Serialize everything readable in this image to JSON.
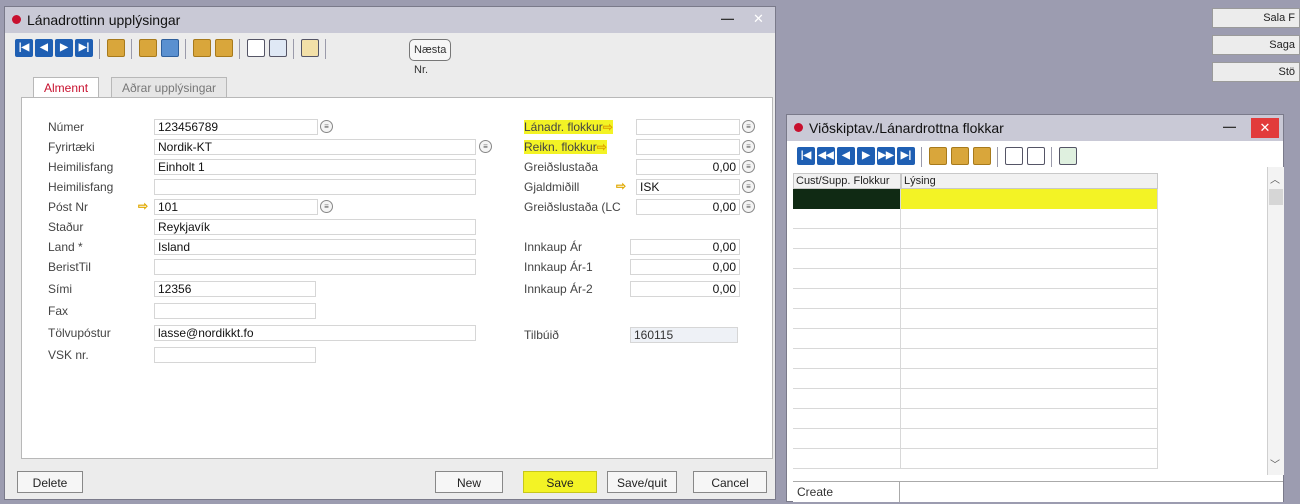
{
  "side_buttons": [
    "Sala F",
    "Saga",
    "Stö"
  ],
  "main_window": {
    "title": "Lánadrottinn upplýsingar",
    "next_button": "Næsta Nr.",
    "tabs": [
      "Almennt",
      "Aðrar upplýsingar"
    ],
    "left_fields": [
      {
        "label": "Númer",
        "value": "123456789"
      },
      {
        "label": "Fyrirtæki",
        "value": "Nordik-KT"
      },
      {
        "label": "Heimilisfang",
        "value": "Einholt 1"
      },
      {
        "label": "Heimilisfang",
        "value": ""
      },
      {
        "label": "Póst Nr",
        "value": "101"
      },
      {
        "label": "Staður",
        "value": "Reykjavík"
      },
      {
        "label": "Land *",
        "value": "Island"
      },
      {
        "label": "BeristTil",
        "value": ""
      },
      {
        "label": "Sími",
        "value": "12356"
      },
      {
        "label": "Fax",
        "value": ""
      },
      {
        "label": "Tölvupóstur",
        "value": "lasse@nordikkt.fo"
      },
      {
        "label": "VSK nr.",
        "value": ""
      }
    ],
    "right_fields": [
      {
        "label": "Lánadr. flokkur",
        "value": ""
      },
      {
        "label": "Reikn. flokkur",
        "value": ""
      },
      {
        "label": "Greiðslustaða",
        "value": "0,00"
      },
      {
        "label": "Gjaldmiðill",
        "value": "ISK"
      },
      {
        "label": "Greiðslustaða (LC",
        "value": "0,00"
      },
      {
        "label": "Innkaup Ár",
        "value": "0,00"
      },
      {
        "label": "Innkaup Ár-1",
        "value": "0,00"
      },
      {
        "label": "Innkaup Ár-2",
        "value": "0,00"
      },
      {
        "label": "Tilbúið",
        "value": "160115"
      }
    ],
    "buttons": {
      "delete": "Delete",
      "new": "New",
      "save": "Save",
      "save_quit": "Save/quit",
      "cancel": "Cancel"
    }
  },
  "group_window": {
    "title": "Viðskiptav./Lánardrottna flokkar",
    "columns": [
      "Cust/Supp. Flokkur",
      "Lýsing"
    ],
    "status": "Create"
  },
  "colors": {
    "highlight": "#f3f325",
    "accent": "#c8102e",
    "nav_blue": "#1f5fb3"
  }
}
